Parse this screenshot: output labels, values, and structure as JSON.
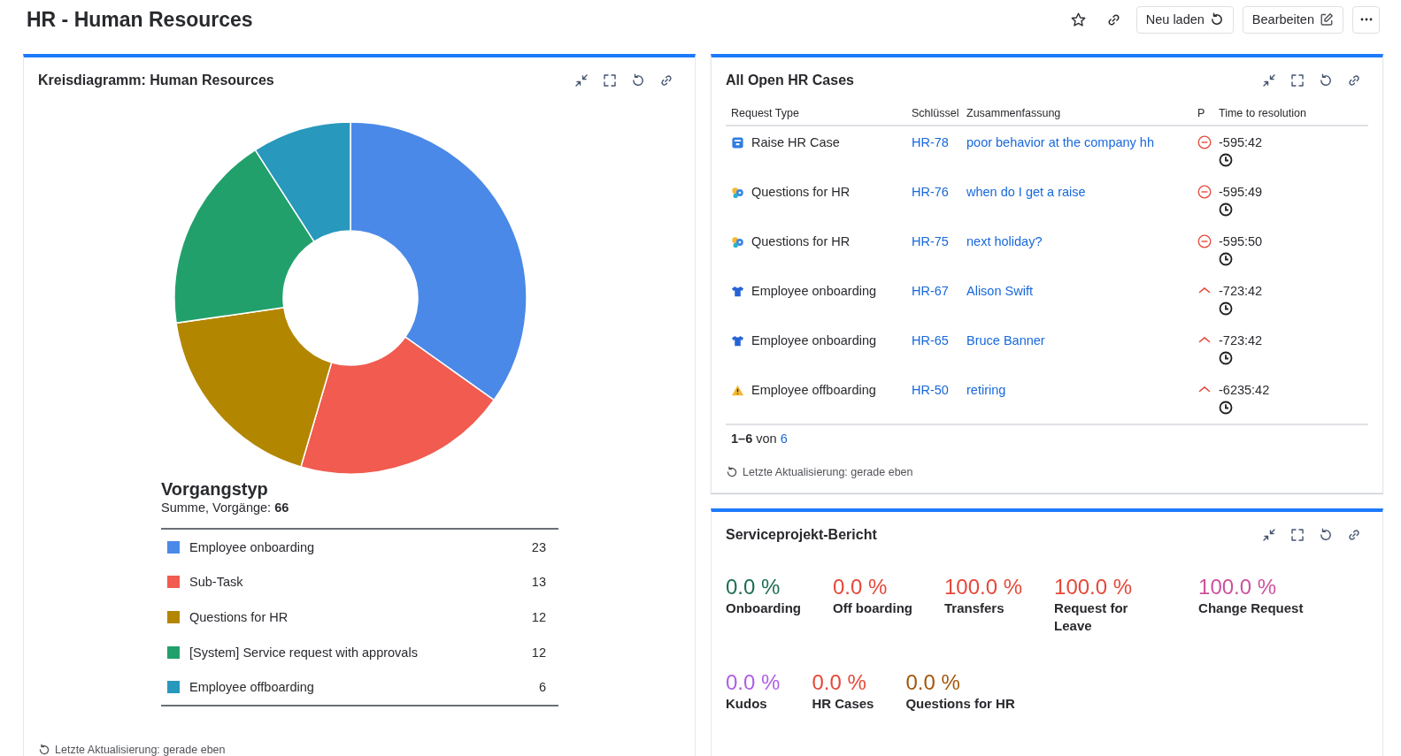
{
  "header": {
    "title": "HR - Human Resources",
    "starred": false,
    "buttons": [
      {
        "kind": "reload",
        "label": "Neu laden"
      },
      {
        "kind": "edit",
        "label": "Bearbeiten"
      }
    ]
  },
  "pie_gadget": {
    "title": "Kreisdiagramm: Human Resources",
    "chart_data": {
      "type": "donut",
      "title": "Vorgangstyp",
      "categories": [
        "Employee onboarding",
        "Sub-Task",
        "Questions for HR",
        "[System] Service request with approvals",
        "Employee offboarding"
      ],
      "values": [
        23,
        13,
        12,
        12,
        6
      ],
      "value_labels": [
        "23",
        "13",
        "12",
        "12",
        "6"
      ],
      "legend": "bottom"
    },
    "summary": "Summe, Vorgänge: **66**",
    "slices": [
      {
        "color": "#4a89e8"
      },
      {
        "color": "#f15b50"
      },
      {
        "color": "#b38600"
      },
      {
        "color": "#22a06b"
      },
      {
        "color": "#2898bd"
      }
    ],
    "footer": "Letzte Aktualisierung: gerade eben"
  },
  "cases_gadget": {
    "title": "All Open HR Cases",
    "columns": [
      "Request Type",
      "Schlüssel",
      "Zusammenfassung",
      "P",
      "Time to resolution"
    ],
    "rows": [
      {
        "request": {
          "kind": "hr_case",
          "label": "Raise HR Case"
        },
        "key": "HR-78",
        "summary": "poor behavior at the company hh",
        "priority": {
          "kind": "blocker"
        },
        "time": "-595:42"
      },
      {
        "request": {
          "kind": "question",
          "label": "Questions for HR"
        },
        "key": "HR-76",
        "summary": "when do I get a raise",
        "priority": {
          "kind": "blocker"
        },
        "time": "-595:49"
      },
      {
        "request": {
          "kind": "question",
          "label": "Questions for HR"
        },
        "key": "HR-75",
        "summary": "next holiday?",
        "priority": {
          "kind": "blocker"
        },
        "time": "-595:50"
      },
      {
        "request": {
          "kind": "onboarding",
          "label": "Employee onboarding"
        },
        "key": "HR-67",
        "summary": "Alison Swift",
        "priority": {
          "kind": "high"
        },
        "time": "-723:42"
      },
      {
        "request": {
          "kind": "onboarding",
          "label": "Employee onboarding"
        },
        "key": "HR-65",
        "summary": "Bruce Banner",
        "priority": {
          "kind": "high"
        },
        "time": "-723:42"
      },
      {
        "request": {
          "kind": "offboarding",
          "label": "Employee offboarding"
        },
        "key": "HR-50",
        "summary": "retiring",
        "priority": {
          "kind": "high"
        },
        "time": "-6235:42"
      }
    ],
    "pagination": {
      "text": "**1–6** von",
      "total": "6"
    },
    "footer": "Letzte Aktualisierung: gerade eben"
  },
  "report_gadget": {
    "title": "Serviceprojekt-Bericht",
    "metrics": [
      {
        "value": "0.0 %",
        "label": "Onboarding",
        "color": "#1e6e50"
      },
      {
        "value": "0.0 %",
        "label": "Off boarding",
        "color": "#e5483a"
      },
      {
        "value": "100.0 %",
        "label": "Transfers",
        "color": "#e5483a"
      },
      {
        "value": "100.0 %",
        "label": "Request for Leave",
        "color": "#e5483a"
      },
      {
        "value": "100.0 %",
        "label": "Change Request",
        "color": "#cd519d"
      },
      {
        "value": "0.0 %",
        "label": "Kudos",
        "color": "#b05ee6"
      },
      {
        "value": "0.0 %",
        "label": "HR Cases",
        "color": "#e5483a"
      },
      {
        "value": "0.0 %",
        "label": "Questions for HR",
        "color": "#a3570b"
      }
    ]
  }
}
